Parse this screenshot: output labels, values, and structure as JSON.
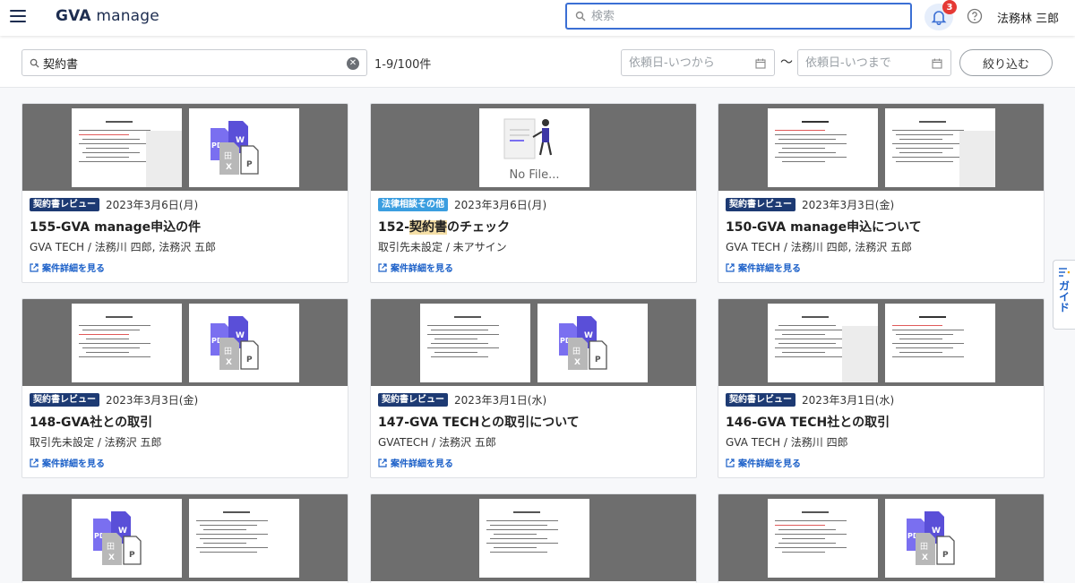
{
  "header": {
    "logo_main": "GVA",
    "logo_sub": " manage",
    "search_placeholder": "検索",
    "notifications_count": "3",
    "user_name": "法務林 三郎"
  },
  "filters": {
    "keyword": "契約書",
    "result_count": "1-9/100件",
    "date_from_placeholder": "依頼日-いつから",
    "date_to_placeholder": "依頼日-いつまで",
    "range_separator": "〜",
    "apply_label": "絞り込む"
  },
  "cards": [
    {
      "category": "契約書レビュー",
      "date": "2023年3月6日(月)",
      "title": "155-GVA manage申込の件",
      "parties": "GVA TECH / 法務川 四郎, 法務沢 五郎",
      "link": "案件詳細を見る"
    },
    {
      "category": "法律相談その他",
      "date": "2023年3月6日(月)",
      "title_pre": "152-",
      "title_hl": "契約書",
      "title_post": "のチェック",
      "parties": "取引先未設定 / 未アサイン",
      "link": "案件詳細を見る",
      "nofile": "No File..."
    },
    {
      "category": "契約書レビュー",
      "date": "2023年3月3日(金)",
      "title": "150-GVA manage申込について",
      "parties": "GVA TECH / 法務川 四郎, 法務沢 五郎",
      "link": "案件詳細を見る"
    },
    {
      "category": "契約書レビュー",
      "date": "2023年3月3日(金)",
      "title": "148-GVA社との取引",
      "parties": "取引先未設定 / 法務沢 五郎",
      "link": "案件詳細を見る"
    },
    {
      "category": "契約書レビュー",
      "date": "2023年3月1日(水)",
      "title": "147-GVA TECHとの取引について",
      "parties": "GVATECH / 法務沢 五郎",
      "link": "案件詳細を見る"
    },
    {
      "category": "契約書レビュー",
      "date": "2023年3月1日(水)",
      "title": "146-GVA TECH社との取引",
      "parties": "GVA TECH / 法務川 四郎",
      "link": "案件詳細を見る"
    }
  ],
  "file_icons": {
    "pdf": "PDF",
    "word": "W",
    "excel": "X",
    "plain": "P",
    "sheet": "田"
  },
  "guide_label": "ガイド",
  "colors": {
    "accent": "#3b6fd4",
    "review_badge": "#1d3a73",
    "legal_badge": "#3b9ee0",
    "link": "#1a5fc8",
    "highlight": "#f5dfa6"
  }
}
